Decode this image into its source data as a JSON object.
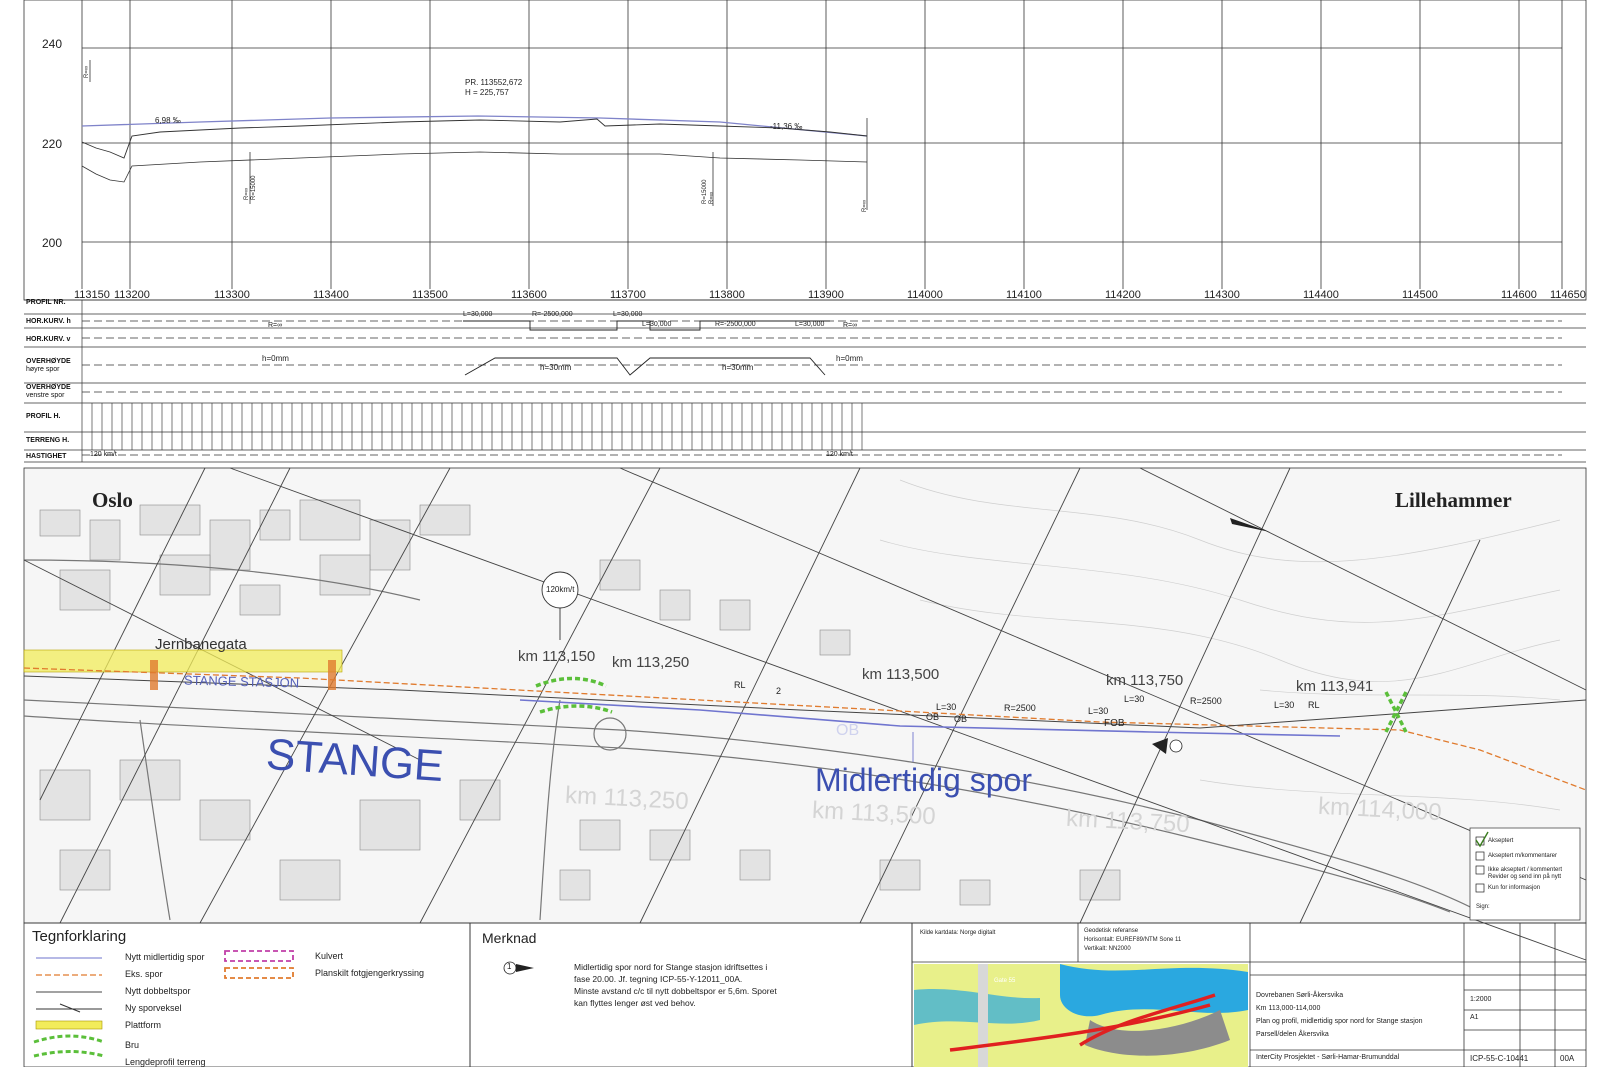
{
  "profile": {
    "y_axis": [
      "240",
      "220",
      "200"
    ],
    "annotations": {
      "grade_left": "6,98 ‰",
      "grade_right": "-11,36 ‰",
      "high_point_1": "PR. 113552,672",
      "high_point_2": "H = 225,757",
      "r_start": "R=∞",
      "r_mid_1": "R=∞",
      "r_mid_2": "R=15000",
      "r_mid_3": "R=15000",
      "r_mid_4": "R=∞",
      "r_end": "R=∞"
    }
  },
  "band": {
    "row_labels": {
      "profil_nr": "PROFIL NR.",
      "hor_h": "HOR.KURV. h",
      "hor_v": "HOR.KURV. v",
      "overhoyde_h_1": "OVERHØYDE",
      "overhoyde_h_2": "høyre spor",
      "overhoyde_v_1": "OVERHØYDE",
      "overhoyde_v_2": "venstre spor",
      "profil_h": "PROFIL H.",
      "terreng_h": "TERRENG H.",
      "hastighet": "HASTIGHET"
    },
    "km_ticks": [
      "113150",
      "113200",
      "113300",
      "113400",
      "113500",
      "113600",
      "113700",
      "113800",
      "113900",
      "114000",
      "114100",
      "114200",
      "114300",
      "114400",
      "114500",
      "114600",
      "114650"
    ],
    "curve_texts": {
      "l1": "L=30,000",
      "r1": "R=-2500,000",
      "l2": "L=30,000",
      "l3": "L=30,000",
      "r2": "R=-2500,000",
      "l4": "L=30,000",
      "r_inf_1": "R=∞",
      "r_inf_2": "R=∞"
    },
    "cant_texts": {
      "h0_1": "h=0mm",
      "h30_1": "h=30mm",
      "h30_2": "h=30mm",
      "h0_2": "h=0mm"
    },
    "speed_texts": {
      "s1": "120 km/t",
      "s2": "120 km/t"
    }
  },
  "map": {
    "direction_left": "Oslo",
    "direction_right": "Lillehammer",
    "street": "Jernbanegata",
    "station": "STANGE STASJON",
    "town": "STANGE",
    "temp_track": "Midlertidig spor",
    "speed_circle": "120km/t",
    "km_labels": [
      "km 113,150",
      "km 113,250",
      "km 113,500",
      "km 113,750",
      "km 113,941"
    ],
    "km_labels_faded": [
      "km 113,250",
      "km 113,500",
      "km 113,750",
      "km 114,000"
    ],
    "track_labels": {
      "rl1": "RL",
      "two": "2",
      "ob1": "OB",
      "l30_1": "L=30",
      "r2500_1": "R=2500",
      "ob2": "OB",
      "l30_2": "L=30",
      "l30_3": "L=30",
      "r2500_2": "R=2500",
      "fob": "FOB",
      "l30_4": "L=30",
      "rl2": "RL",
      "ob_main": "OB"
    },
    "status_box": [
      "Akseptert",
      "Akseptert m/kommentarer",
      "Ikke akseptert / kommentert Revider og send inn på nytt",
      "Kun for informasjon",
      "Sign:"
    ],
    "status_checked_index": 0
  },
  "legend": {
    "title": "Tegnforklaring",
    "items": [
      {
        "label": "Nytt midlertidig spor",
        "color": "#8a8fd6"
      },
      {
        "label": "Eks. spor",
        "color": "#e07b2e"
      },
      {
        "label": "Nytt dobbeltspor",
        "color": "#444444"
      },
      {
        "label": "Ny sporveksel",
        "color": "#333333"
      },
      {
        "label": "Plattform",
        "color": "#f2ec5a"
      },
      {
        "label": "Bru",
        "color": "#5bbf3a"
      },
      {
        "label": "Lengdeprofil terreng",
        "color": "#333333"
      }
    ],
    "items_right": [
      {
        "label": "Kulvert",
        "color": "#c03ea8"
      },
      {
        "label": "Planskilt fotgjengerkryssing",
        "color": "#e07b2e"
      }
    ]
  },
  "note": {
    "title": "Merknad",
    "number": "1",
    "lines": [
      "Midlertidig spor nord for Stange stasjon idriftsettes i",
      "fase 20.00. Jf. tegning ICP-55-Y-12011_00A.",
      "Minste avstand c/c til nytt dobbeltspor er 5,6m. Sporet",
      "kan flyttes lenger øst ved behov."
    ]
  },
  "titleblock": {
    "source": "Kilde kartdata: Norge digitalt",
    "reference_1": "Geodetisk referanse",
    "reference_2": "Horisontalt: EUREF89/NTM Sone 11",
    "reference_3": "Vertikalt: NN2000",
    "map_label": "Gate 55",
    "project_lines": [
      "Dovrebanen Sørli-Åkersvika",
      "Km 113,000-114,000",
      "Plan og profil, midlertidig spor nord for Stange stasjon",
      "Parsell/delen Åkersvika"
    ],
    "owner": "InterCity Prosjektet - Sørli-Hamar-Brumunddal",
    "scale": "1:2000",
    "format": "A1",
    "drawing_no": "ICP-55-C-10441",
    "revision": "00A"
  }
}
